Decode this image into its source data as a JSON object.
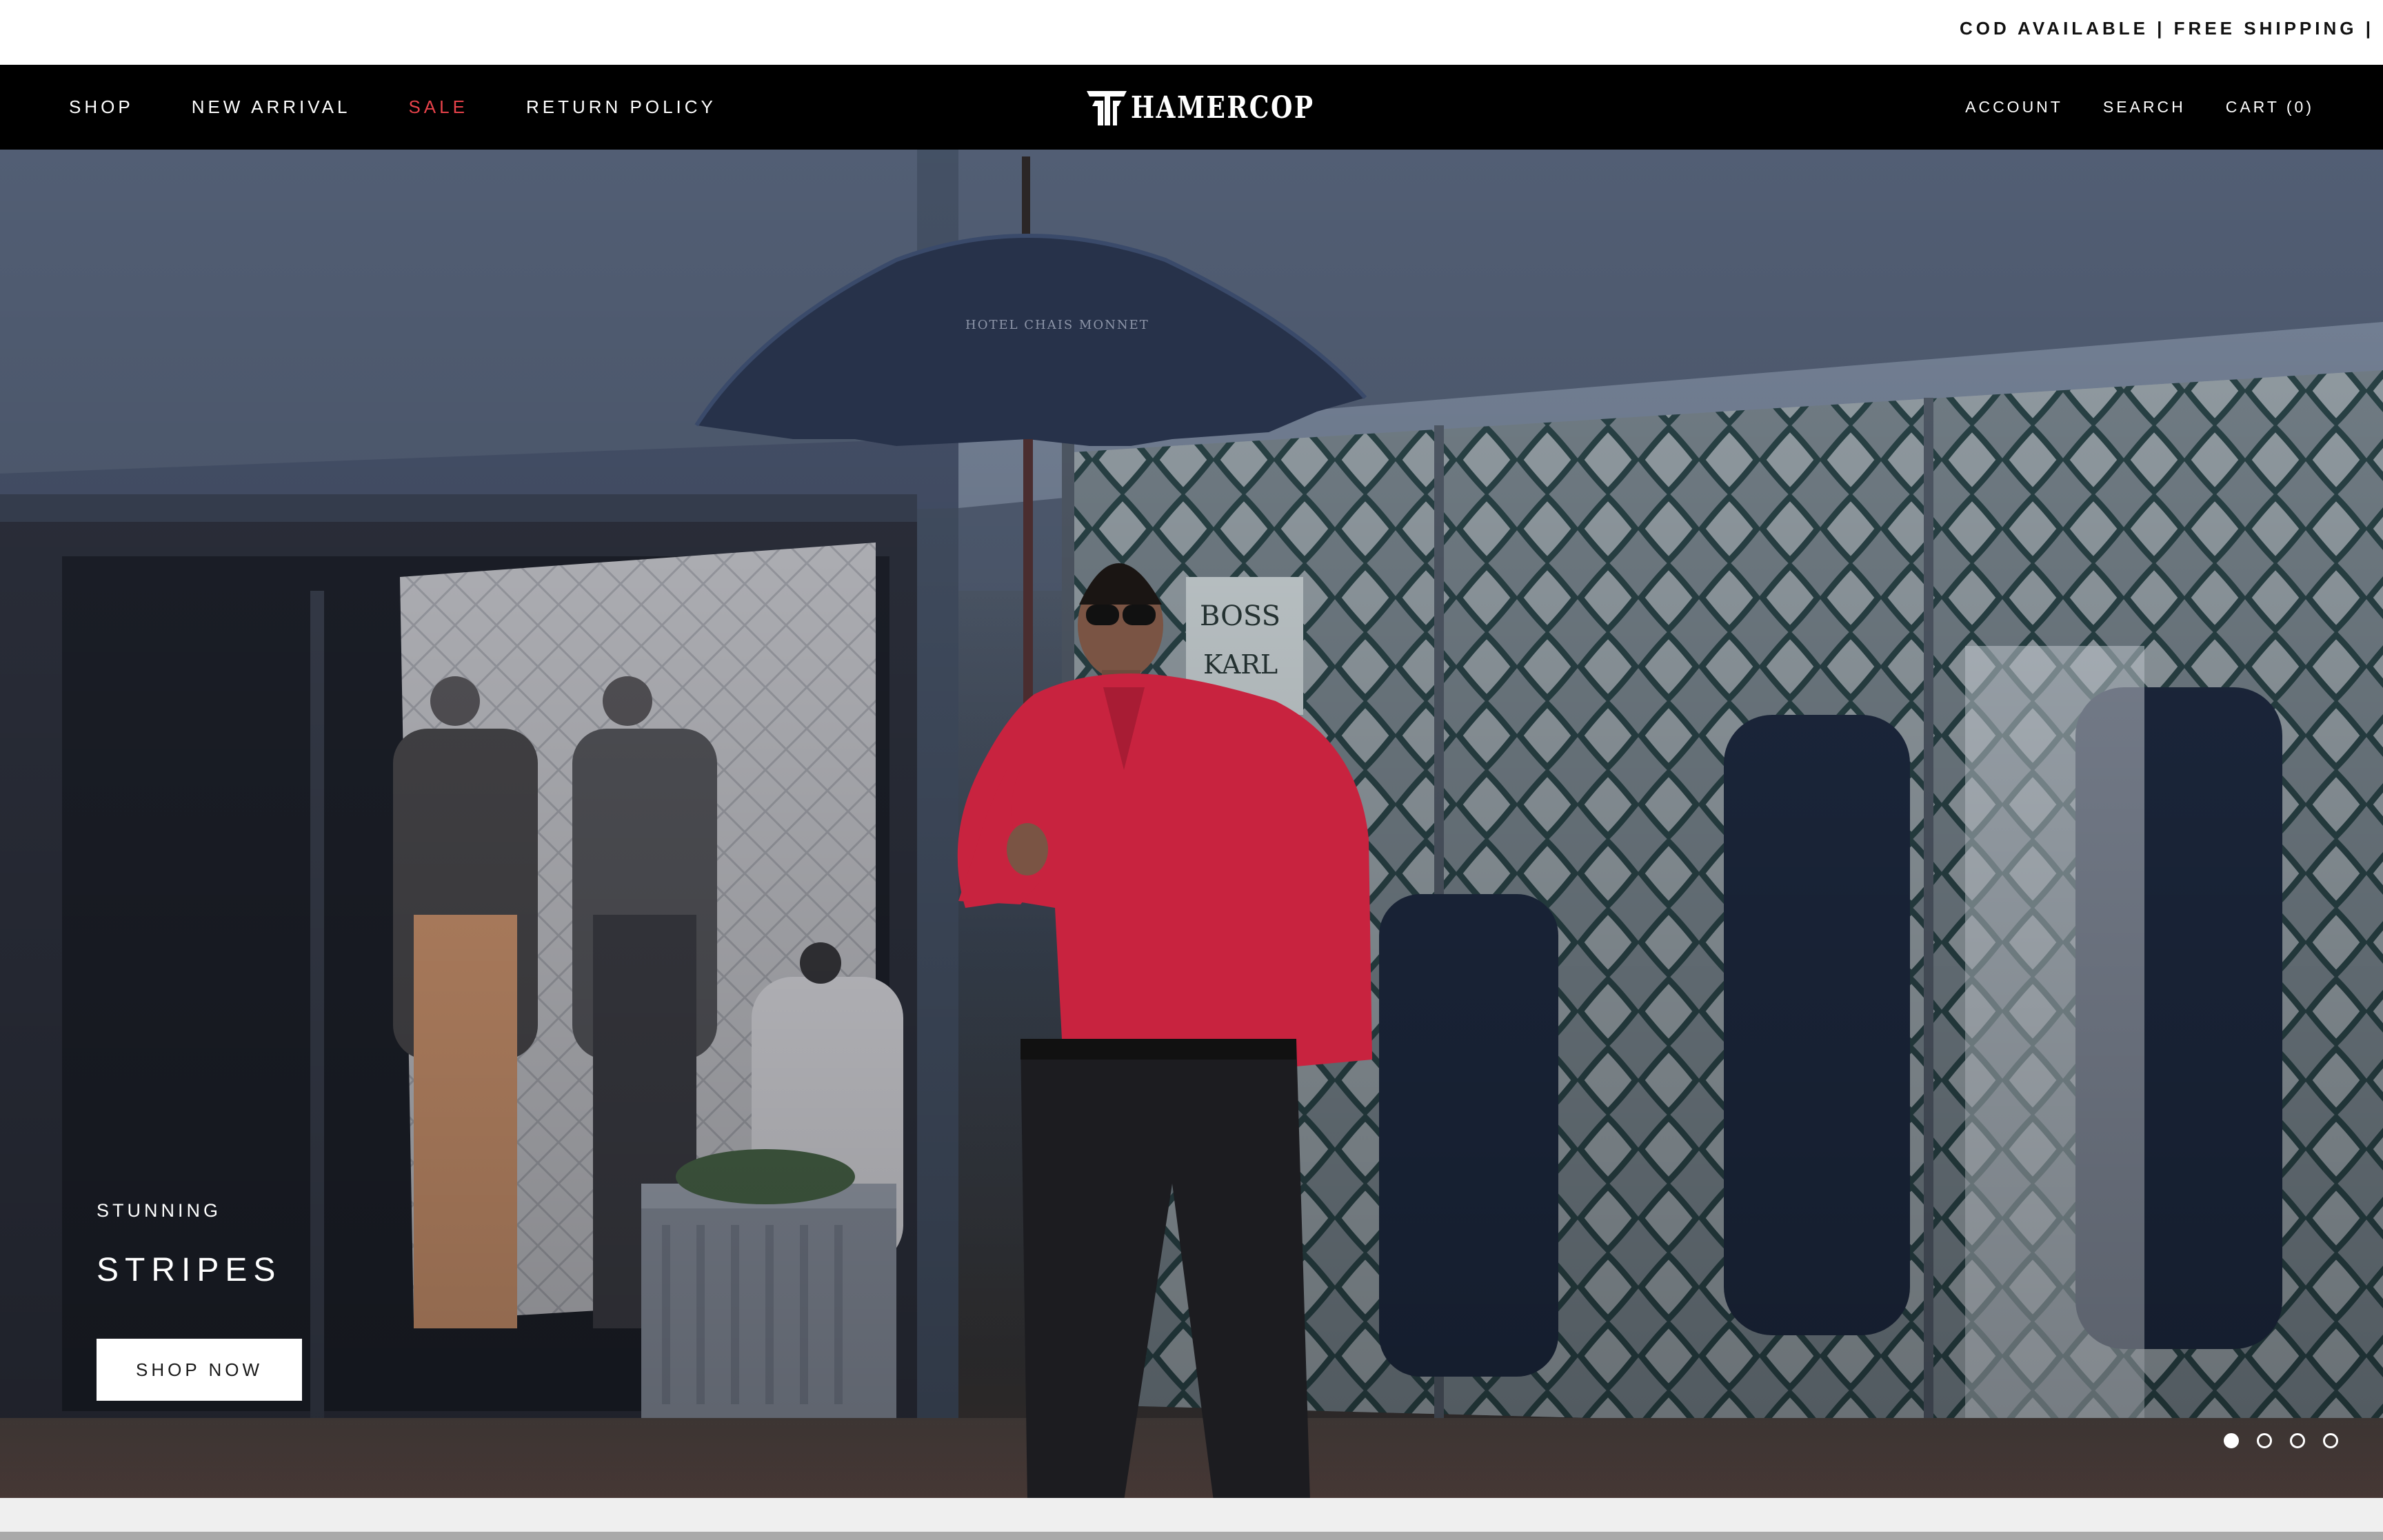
{
  "announcement": {
    "text": "COD AVAILABLE | FREE SHIPPING | EAS"
  },
  "header": {
    "nav_left": [
      {
        "label": "SHOP"
      },
      {
        "label": "NEW ARRIVAL"
      },
      {
        "label": "SALE"
      },
      {
        "label": "RETURN POLICY"
      }
    ],
    "logo_text": "HAMERCOP",
    "nav_right": [
      {
        "label": "ACCOUNT"
      },
      {
        "label": "SEARCH"
      },
      {
        "label": "CART (0)"
      }
    ]
  },
  "hero": {
    "subtitle": "STUNNING",
    "title": "STRIPES",
    "button_label": "SHOP NOW",
    "store_signs": [
      "BOSS",
      "KARL"
    ],
    "umbrella_text": "HOTEL CHAIS MONNET",
    "slides": {
      "count": 4,
      "active": 1
    }
  },
  "colors": {
    "sale": "#e8424a",
    "header_bg": "#000000",
    "shirt": "#c8233f"
  },
  "icons": [
    "hamercop-logo-icon"
  ]
}
